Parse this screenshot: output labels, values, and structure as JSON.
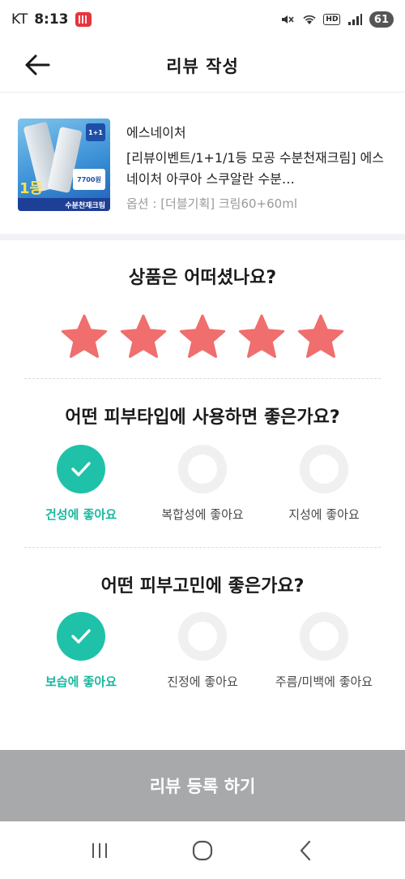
{
  "status_bar": {
    "carrier": "KT",
    "time": "8:13",
    "hd_label": "HD",
    "battery": "61"
  },
  "header": {
    "title": "리뷰 작성"
  },
  "product": {
    "brand": "에스네이처",
    "name": "[리뷰이벤트/1+1/1등 모공 수분천재크림] 에스네이처 아쿠아 스쿠알란 수분…",
    "option": "옵션 : [더블기획] 크림60+60ml",
    "thumbnail": {
      "badge": "1+1",
      "price": "7700원",
      "rank": "1등",
      "ribbon": "수분천재크림"
    }
  },
  "rating": {
    "question": "상품은 어떠셨나요?",
    "value": 5,
    "max": 5,
    "star_color": "#f06e6e"
  },
  "skin_type": {
    "question": "어떤 피부타입에 사용하면 좋은가요?",
    "options": [
      {
        "label": "건성에 좋아요",
        "selected": true
      },
      {
        "label": "복합성에 좋아요",
        "selected": false
      },
      {
        "label": "지성에 좋아요",
        "selected": false
      }
    ]
  },
  "skin_concern": {
    "question": "어떤 피부고민에 좋은가요?",
    "options": [
      {
        "label": "보습에 좋아요",
        "selected": true
      },
      {
        "label": "진정에 좋아요",
        "selected": false
      },
      {
        "label": "주름/미백에 좋아요",
        "selected": false
      }
    ]
  },
  "submit": {
    "label": "리뷰 등록 하기"
  },
  "colors": {
    "accent": "#1fc2a9",
    "star": "#f06e6e",
    "submit_disabled": "#a8a9ab"
  }
}
